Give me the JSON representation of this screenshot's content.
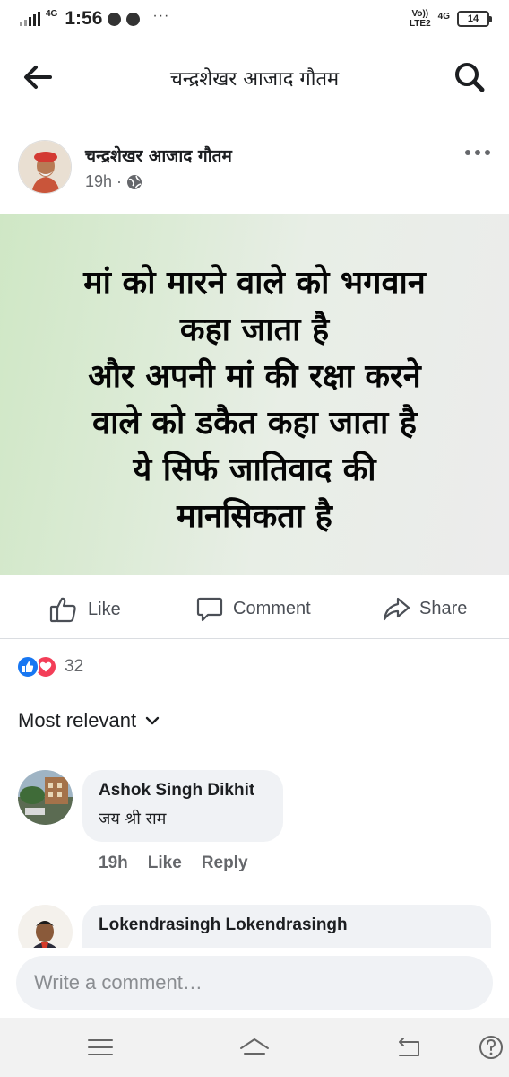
{
  "status_bar": {
    "network": "4G",
    "time": "1:56",
    "more": "···",
    "volte_top": "Vo))",
    "volte_bottom": "LTE2",
    "network2": "4G",
    "battery": "14"
  },
  "header": {
    "title": "चन्द्रशेखर आजाद गौतम",
    "back_icon": "arrow-left-icon",
    "search_icon": "search-icon"
  },
  "post": {
    "author": "चन्द्रशेखर आजाद गौतम",
    "time": "19h",
    "separator": "·",
    "privacy_icon": "globe-icon",
    "image_text_lines": [
      "मां को मारने वाले को भगवान",
      "कहा जाता है",
      "और अपनी मां की रक्षा करने",
      "वाले को डकैत कहा जाता है",
      "ये सिर्फ जातिवाद की",
      "मानसिकता है"
    ]
  },
  "actions": {
    "like": "Like",
    "comment": "Comment",
    "share": "Share"
  },
  "reactions": {
    "count": "32",
    "colors": {
      "like": "#1877f2",
      "love": "#f33e58"
    }
  },
  "sort": {
    "label": "Most relevant"
  },
  "comments": [
    {
      "name": "Ashok Singh Dikhit",
      "text": "जय श्री राम",
      "time": "19h",
      "like": "Like",
      "reply": "Reply"
    },
    {
      "name": "Lokendrasingh Lokendrasingh",
      "text": ""
    }
  ],
  "composer": {
    "placeholder": "Write a comment…"
  },
  "navbar": {
    "menu_icon": "menu-icon",
    "home_icon": "home-icon",
    "back_icon": "back-icon",
    "help_icon": "help-icon"
  }
}
